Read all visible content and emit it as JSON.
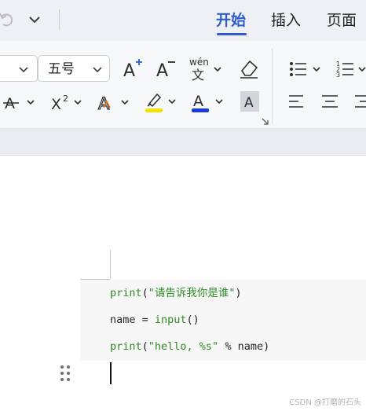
{
  "tabs": [
    {
      "label": "开始",
      "active": true
    },
    {
      "label": "插入",
      "active": false
    },
    {
      "label": "页面",
      "active": false
    }
  ],
  "quick_access": {
    "redo_icon": "redo-icon",
    "more_icon": "chevron-down-icon"
  },
  "ribbon": {
    "font_size_value": "五号",
    "font_name_value": "",
    "increase_font_label": "A",
    "decrease_font_label": "A",
    "pinyin_label": "wén",
    "pinyin_char": "文",
    "superscript_label": "X²",
    "text_effect_label": "A",
    "font_color_label": "A",
    "char_shading_label": "A",
    "colors": {
      "highlight": "#f5e100",
      "font_color": "#1a3bd6",
      "increase_plus": "#2f5dcc",
      "active_tab": "#2f5dcc",
      "text_effect": "#e07a10"
    }
  },
  "document": {
    "code_lines": [
      {
        "func": "print",
        "rest_open": "(",
        "string": "\"请告诉我你是谁\"",
        "rest_close": ")"
      },
      {
        "prefix": "name = ",
        "func": "input",
        "suffix": "()"
      },
      {
        "func": "print",
        "rest_open": "(",
        "string": "\"hello, %s\"",
        "rest_close": " % name)"
      }
    ]
  },
  "watermark": "CSDN @打磨的石头"
}
